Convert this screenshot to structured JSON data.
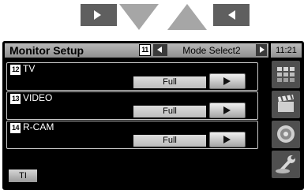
{
  "screen": {
    "title": "Monitor Setup",
    "mode_label": "Mode Select2",
    "clock": "11:21",
    "ti_label": "TI"
  },
  "callouts": {
    "mode": "11",
    "tv": "12",
    "video": "13",
    "rcam": "14"
  },
  "rows": [
    {
      "label": "TV",
      "value": "Full"
    },
    {
      "label": "VIDEO",
      "value": "Full"
    },
    {
      "label": "R-CAM",
      "value": "Full"
    }
  ],
  "icons": {
    "nav_next": "play-right-icon",
    "nav_down": "triangle-down-icon",
    "nav_up": "triangle-up-icon",
    "nav_prev": "play-left-icon",
    "sidebar": [
      "grid-menu-icon",
      "clapperboard-icon",
      "speaker-icon",
      "wrench-icon"
    ]
  },
  "colors": {
    "screen_bg": "#000000",
    "header_bg": "#a4a4a4",
    "value_bg": "#cccccc",
    "text_light": "#ffffff"
  }
}
